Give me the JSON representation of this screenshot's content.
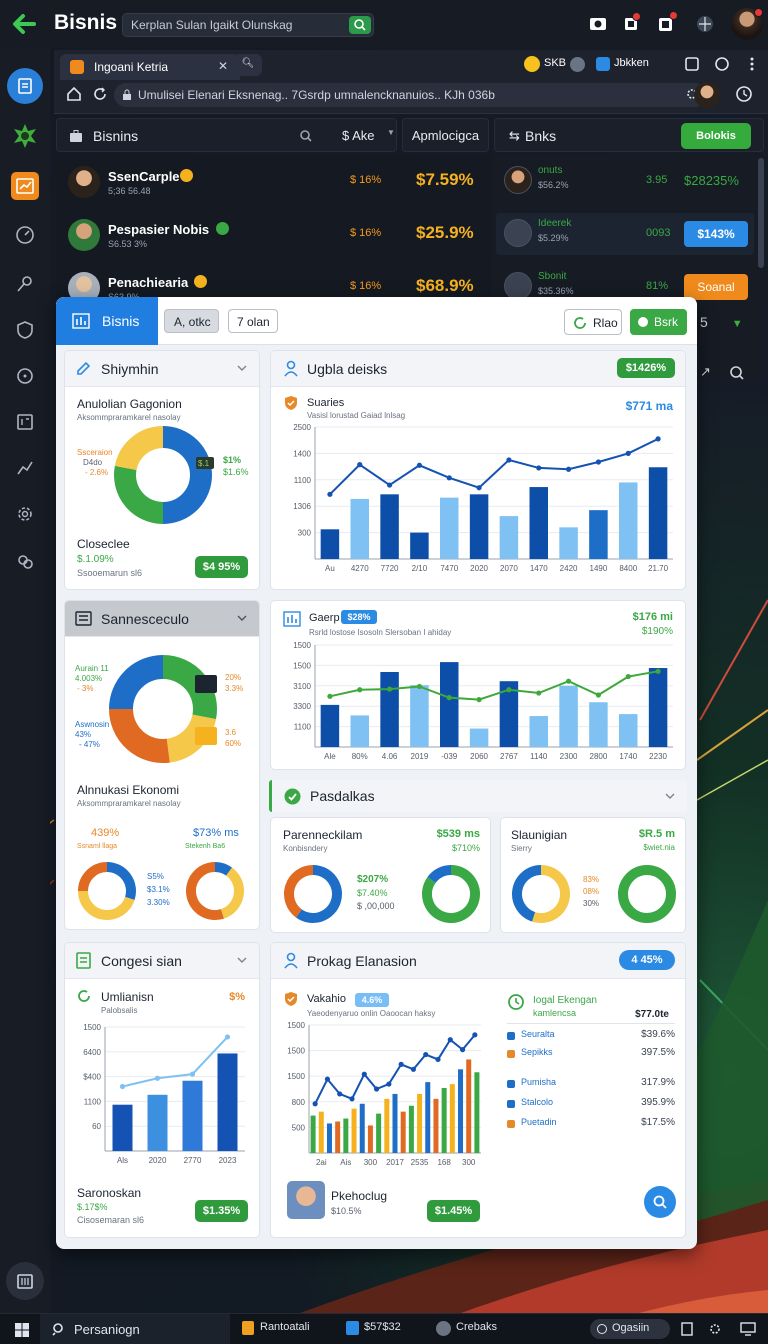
{
  "app": {
    "title": "Bisnis",
    "search_placeholder": "Kerplan Sulan Igaikt Olunskag"
  },
  "browser": {
    "tab_title": "Ingoani Ketria",
    "url": "Umulisei Elenari Eksnenag.. 7Gsrdp umnalencknanuios.. KJh 036b",
    "ext1": "SKB",
    "ext2": "Jbkken"
  },
  "top_list": {
    "header": "Bisnins",
    "currency": "$ Ake",
    "col2": "Apmlocigca",
    "rows": [
      {
        "name": "SsenCarple",
        "sub": "5;36 56.48",
        "a": "$ 16%",
        "b": "$7.59%"
      },
      {
        "name": "Pespasier Nobis",
        "sub": "S6.53 3%",
        "a": "$ 16%",
        "b": "$25.9%"
      },
      {
        "name": "Penachiearia",
        "sub": "S63.9%",
        "a": "$ 16%",
        "b": "$68.9%"
      }
    ]
  },
  "right_list": {
    "header": "Bnks",
    "header_btn": "Bolokis",
    "rows": [
      {
        "name": "onuts",
        "sub": "$56.2%",
        "a": "3.95",
        "b": "$28235%",
        "style": "text"
      },
      {
        "name": "Ideerek",
        "sub": "$5.29%",
        "a": "0093",
        "b": "$143%",
        "style": "blue"
      },
      {
        "name": "Sbonit",
        "sub": "$35.36%",
        "a": "81%",
        "b": "Soanal",
        "style": "orange"
      }
    ]
  },
  "main": {
    "tab_label": "Bisnis",
    "filter1": "A, otkc",
    "filter2": "7 olan",
    "btn_nav": "Rlao",
    "btn_go": "Bsrk"
  },
  "card_shipment": {
    "title": "Shiymhin",
    "chart_title": "Anulolian Gagonion",
    "chart_sub": "Aksommpraramkarel nasolay",
    "left_labels": [
      "Ssceraion",
      "D4do",
      "- 2.6%"
    ],
    "right_labels": [
      "$1%",
      "$1.6%"
    ],
    "center_label": "$.1",
    "footer_title": "Closeclee",
    "footer_val": "$.1.09%",
    "footer_sub": "Ssooemarun sl6",
    "badge": "$4 95%",
    "chart_data": {
      "type": "pie",
      "slices": [
        {
          "label": "blue",
          "value": 50
        },
        {
          "label": "green",
          "value": 28
        },
        {
          "label": "yellow",
          "value": 22
        }
      ]
    }
  },
  "card_stocks": {
    "title": "Ugbla deisks",
    "badge": "$1426%",
    "chart_title": "Suaries",
    "chart_sub": "Vasisl lorustad Gaiad lnlsag",
    "chart_value": "$771 ma",
    "chart_data": {
      "type": "bar",
      "categories": [
        "Au",
        "4270",
        "7720",
        "2/10",
        "7470",
        "2020",
        "2070",
        "1470",
        "2420",
        "1490",
        "8400",
        "21.70"
      ],
      "values": [
        450,
        910,
        980,
        400,
        930,
        980,
        650,
        1090,
        480,
        740,
        1160,
        1390
      ],
      "line": [
        980,
        1430,
        1120,
        1420,
        1230,
        1080,
        1500,
        1380,
        1360,
        1470,
        1600,
        1820
      ],
      "yticks": [
        "300",
        "1306",
        "1100",
        "1400",
        "2500"
      ],
      "ylim": [
        0,
        2000
      ]
    }
  },
  "card_sales": {
    "title": "Sannesceculo",
    "labels_left_top": [
      "Aurain 11",
      "4.003%",
      "- 3%"
    ],
    "labels_right_top": [
      "20%",
      "3.3%"
    ],
    "labels_left_bot": [
      "Aswnosin",
      "43%",
      "- 47%"
    ],
    "labels_right_bot": [
      "3.6",
      "60%"
    ],
    "chart_data": {
      "type": "pie",
      "slices": [
        {
          "label": "green",
          "value": 28
        },
        {
          "label": "yellow",
          "value": 20
        },
        {
          "label": "orange",
          "value": 27
        },
        {
          "label": "blue",
          "value": 25
        }
      ]
    }
  },
  "card_garp": {
    "title": "Gaerp",
    "pill": "$28%",
    "sub": "Rsrld lostose Isosoln Slersoban I ahiday",
    "val1": "$176 mi",
    "val2": "$190%",
    "chart_data": {
      "type": "bar",
      "categories": [
        "Ale",
        "80%",
        "4.06",
        "2019",
        "-039",
        "2060",
        "2767",
        "1140",
        "2300",
        "2800",
        "1740",
        "2230"
      ],
      "values": [
        640,
        480,
        1140,
        940,
        1290,
        280,
        1000,
        470,
        930,
        680,
        500,
        1200
      ],
      "line": [
        770,
        870,
        880,
        920,
        750,
        720,
        870,
        820,
        1000,
        790,
        1070,
        1150
      ],
      "yticks": [
        "1100",
        "3300",
        "3100",
        "1500",
        "1500"
      ],
      "ylim": [
        0,
        1550
      ]
    }
  },
  "card_alloc": {
    "title": "Alnnukasi Ekonomi",
    "sub": "Aksommpraramkarel nasolay",
    "left_val": "439%",
    "left_tag": "Ssnaml llaga",
    "right_val": "$73% ms",
    "right_tag": "Stekenh Ba6",
    "mid": [
      "S5%",
      "$3.1%",
      "3.30%"
    ],
    "chart_data": {
      "type": "pie",
      "donuts": [
        {
          "blue": 30,
          "yellow": 45,
          "orange": 25
        },
        {
          "blue": 10,
          "yellow": 35,
          "orange": 55
        }
      ]
    }
  },
  "card_padalkas": {
    "title": "Pasdalkas",
    "left": {
      "title": "Parenneckilam",
      "sub": "Konbisndery",
      "val1": "$539 ms",
      "val2": "$710%",
      "mid": [
        "$207%",
        "$7.40%",
        "$ ,00,000"
      ]
    },
    "right": {
      "title": "Slaunigian",
      "sub": "Sierry",
      "val1": "$R.5 m",
      "val2": "$wiet.nia",
      "mid": [
        "83%",
        "08%",
        "30%"
      ]
    },
    "chart_data": {
      "type": "pie",
      "donuts": [
        {
          "blue": 60,
          "orange": 40
        },
        {
          "green": 85,
          "blue": 15
        },
        {
          "yellow": 55,
          "blue": 45
        },
        {
          "green": 100
        }
      ]
    }
  },
  "card_congesi": {
    "title": "Congesi sian",
    "chart_title": "Umlianisn",
    "chart_sub": "Palobsalis",
    "tag": "$%",
    "footer_title": "Saronoskan",
    "footer_val": "$.17$%",
    "footer_sub": "Cisosemaran sl6",
    "badge": "$1.35%",
    "chart_data": {
      "type": "bar",
      "categories": [
        "Als",
        "2020",
        "2770",
        "2023"
      ],
      "values": [
        560,
        680,
        850,
        1180
      ],
      "line": [
        780,
        880,
        930,
        1380
      ],
      "yticks": [
        "60",
        "1100",
        "$400",
        "6400",
        "1500"
      ],
      "ylim": [
        0,
        1500
      ]
    }
  },
  "card_prokag": {
    "title": "Prokag Elanasion",
    "badge": "4 45%",
    "chart_title": "Vakahio",
    "chart_pill": "4.6%",
    "chart_sub": "Yaeodenyaruo onlin Oaoocan haksy",
    "footer_name": "Pkehoclug",
    "footer_val": "$10.5%",
    "footer_badge": "$1.45%",
    "chart_data": {
      "type": "bar",
      "categories": [
        "2ai",
        "Ais",
        "300",
        "2017",
        "2535",
        "168",
        "300"
      ],
      "values": [
        38,
        42,
        30,
        32,
        35,
        45,
        50,
        28,
        40,
        55,
        60,
        42,
        48,
        60,
        72,
        55,
        66,
        70,
        85,
        95,
        82
      ],
      "line": [
        50,
        75,
        60,
        55,
        80,
        65,
        70,
        90,
        85,
        100,
        95,
        115,
        105,
        120
      ],
      "yticks": [
        "500",
        "800",
        "1500",
        "1500",
        "1500"
      ],
      "ylim": [
        0,
        130
      ]
    },
    "legend_title": "Iogal Ekengan",
    "legend_sub": "kamlencsa",
    "legend_total": "$77.0te",
    "legend": [
      {
        "name": "Seuralta",
        "val": "$39.6%",
        "color": "#1e6ec8"
      },
      {
        "name": "Sepikks",
        "val": "397.5%",
        "color": "#e6892a"
      },
      {
        "name": "Pumisha",
        "val": "317.9%",
        "color": "#1e6ec8"
      },
      {
        "name": "Stalcolo",
        "val": "395.9%",
        "color": "#1e6ec8"
      },
      {
        "name": "Puetadin",
        "val": "$17.5%",
        "color": "#e6892a"
      }
    ]
  },
  "taskbar": {
    "search": "Persaniogn",
    "t1": "Rantoatali",
    "t2": "$57$32",
    "t3": "Crebaks",
    "t4": "Ogasiin"
  }
}
